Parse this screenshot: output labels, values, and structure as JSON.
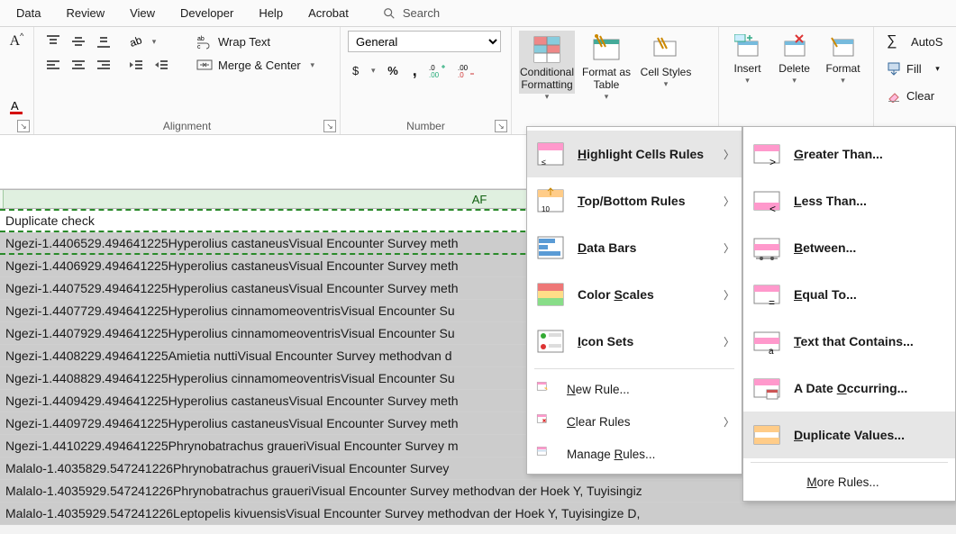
{
  "tabs": [
    "Data",
    "Review",
    "View",
    "Developer",
    "Help",
    "Acrobat"
  ],
  "search_placeholder": "Search",
  "ribbon": {
    "font_a": "A",
    "alignment": {
      "wrap": "Wrap Text",
      "merge": "Merge & Center",
      "group_label": "Alignment"
    },
    "number": {
      "format_selected": "General",
      "group_label": "Number",
      "currency": "$",
      "percent": "%",
      "comma": ","
    },
    "styles": {
      "cond_fmt": "Conditional Formatting",
      "fmt_table": "Format as Table",
      "cell_styles": "Cell Styles"
    },
    "cells": {
      "insert": "Insert",
      "delete": "Delete",
      "format": "Format"
    },
    "editing": {
      "autosum": "AutoS",
      "fill": "Fill",
      "clear": "Clear"
    }
  },
  "column_letter": "AF",
  "header_cell": "Duplicate check",
  "data_rows": [
    "Ngezi-1.4406529.494641225Hyperolius castaneusVisual Encounter Survey meth",
    "Ngezi-1.4406929.494641225Hyperolius castaneusVisual Encounter Survey meth",
    "Ngezi-1.4407529.494641225Hyperolius castaneusVisual Encounter Survey meth",
    "Ngezi-1.4407729.494641225Hyperolius cinnamomeoventrisVisual Encounter Su",
    "Ngezi-1.4407929.494641225Hyperolius cinnamomeoventrisVisual Encounter Su",
    "Ngezi-1.4408229.494641225Amietia nuttiVisual Encounter Survey methodvan d",
    "Ngezi-1.4408829.494641225Hyperolius cinnamomeoventrisVisual Encounter Su",
    "Ngezi-1.4409429.494641225Hyperolius castaneusVisual Encounter Survey meth",
    "Ngezi-1.4409729.494641225Hyperolius castaneusVisual Encounter Survey meth",
    "Ngezi-1.4410229.494641225Phrynobatrachus graueriVisual Encounter Survey m",
    "Malalo-1.4035829.547241226Phrynobatrachus graueriVisual Encounter Survey",
    "Malalo-1.4035929.547241226Phrynobatrachus graueriVisual Encounter Survey methodvan der Hoek Y, Tuyisingiz",
    "Malalo-1.4035929.547241226Leptopelis kivuensisVisual Encounter Survey methodvan der Hoek Y, Tuyisingize D,"
  ],
  "cf_menu": {
    "items": [
      {
        "label_html": "<u>H</u>ighlight Cells Rules",
        "name": "highlight-cells-rules",
        "has_sub": true,
        "hover": true
      },
      {
        "label_html": "<u>T</u>op/Bottom Rules",
        "name": "top-bottom-rules",
        "has_sub": true
      },
      {
        "label_html": "<u>D</u>ata Bars",
        "name": "data-bars",
        "has_sub": true
      },
      {
        "label_html": "Color <u>S</u>cales",
        "name": "color-scales",
        "has_sub": true
      },
      {
        "label_html": "<u>I</u>con Sets",
        "name": "icon-sets",
        "has_sub": true
      }
    ],
    "small": [
      {
        "label_html": "<u>N</u>ew Rule...",
        "name": "new-rule"
      },
      {
        "label_html": "<u>C</u>lear Rules",
        "name": "clear-rules",
        "has_sub": true
      },
      {
        "label_html": "Manage <u>R</u>ules...",
        "name": "manage-rules"
      }
    ]
  },
  "hcr_menu": {
    "items": [
      {
        "label_html": "<u>G</u>reater Than...",
        "name": "greater-than"
      },
      {
        "label_html": "<u>L</u>ess Than...",
        "name": "less-than"
      },
      {
        "label_html": "<u>B</u>etween...",
        "name": "between"
      },
      {
        "label_html": "<u>E</u>qual To...",
        "name": "equal-to"
      },
      {
        "label_html": "<u>T</u>ext that Contains...",
        "name": "text-that-contains"
      },
      {
        "label_html": "A Date <u>O</u>ccurring...",
        "name": "a-date-occurring"
      },
      {
        "label_html": "<u>D</u>uplicate Values...",
        "name": "duplicate-values",
        "hover": true
      }
    ],
    "more": "More Rules..."
  }
}
